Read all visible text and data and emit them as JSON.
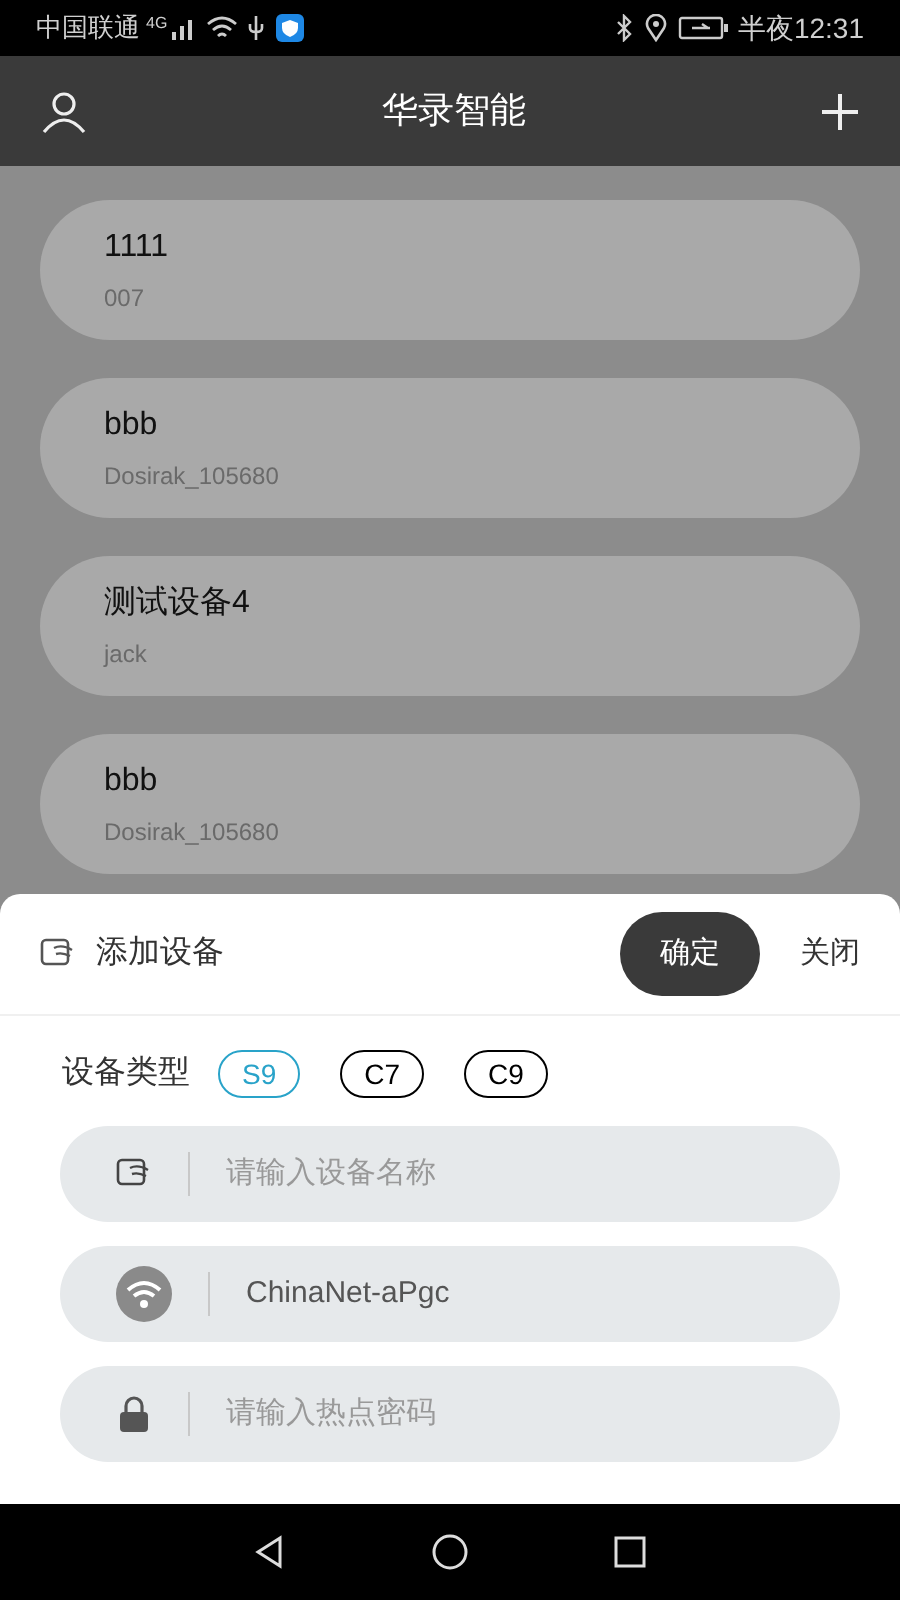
{
  "status_bar": {
    "carrier": "中国联通",
    "network": "4G",
    "time": "半夜12:31"
  },
  "header": {
    "title": "华录智能"
  },
  "devices": [
    {
      "name": "1111",
      "owner": "007"
    },
    {
      "name": "bbb",
      "owner": "Dosirak_105680"
    },
    {
      "name": "测试设备4",
      "owner": "jack"
    },
    {
      "name": "bbb",
      "owner": "Dosirak_105680"
    }
  ],
  "sheet": {
    "title": "添加设备",
    "confirm": "确定",
    "close": "关闭",
    "type_label": "设备类型",
    "types": [
      {
        "label": "S9",
        "selected": true
      },
      {
        "label": "C7",
        "selected": false
      },
      {
        "label": "C9",
        "selected": false
      }
    ],
    "fields": [
      {
        "kind": "device",
        "placeholder": "请输入设备名称"
      },
      {
        "kind": "wifi",
        "value": "ChinaNet-aPgc"
      },
      {
        "kind": "lock",
        "placeholder": "请输入热点密码"
      }
    ]
  }
}
